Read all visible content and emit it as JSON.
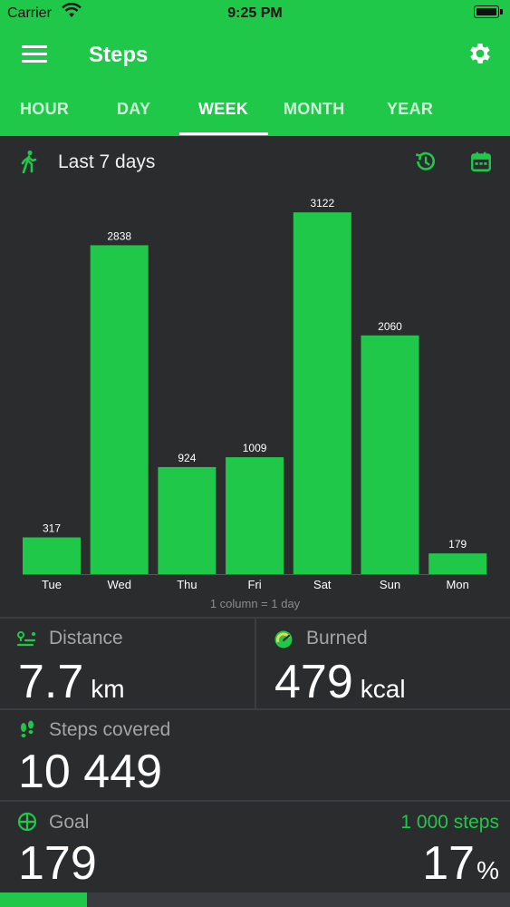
{
  "status_bar": {
    "carrier": "Carrier",
    "time": "9:25 PM"
  },
  "app_bar": {
    "title": "Steps"
  },
  "tabs": [
    {
      "label": "HOUR",
      "active": false
    },
    {
      "label": "DAY",
      "active": false
    },
    {
      "label": "WEEK",
      "active": true
    },
    {
      "label": "MONTH",
      "active": false
    },
    {
      "label": "YEAR",
      "active": false
    }
  ],
  "range": {
    "label": "Last 7 days"
  },
  "chart_data": {
    "type": "bar",
    "categories": [
      "Tue",
      "Wed",
      "Thu",
      "Fri",
      "Sat",
      "Sun",
      "Mon"
    ],
    "values": [
      317,
      2838,
      924,
      1009,
      3122,
      2060,
      179
    ],
    "data_labels": [
      "317",
      "2838",
      "924",
      "1009",
      "3122",
      "2060",
      "179"
    ],
    "ylim": [
      0,
      3350
    ],
    "bar_color": "#20c84a",
    "note": "1 column = 1 day"
  },
  "stats": {
    "distance": {
      "title": "Distance",
      "value": "7.7",
      "unit": "km"
    },
    "burned": {
      "title": "Burned",
      "value": "479",
      "unit": "kcal"
    },
    "steps_covered": {
      "title": "Steps covered",
      "value": "10 449"
    },
    "goal": {
      "title": "Goal",
      "value": "179",
      "target": "1 000 steps",
      "percent": "17",
      "percent_unit": "%",
      "progress": 0.17
    }
  },
  "colors": {
    "accent": "#20c84a",
    "background": "#2b2c2e"
  }
}
